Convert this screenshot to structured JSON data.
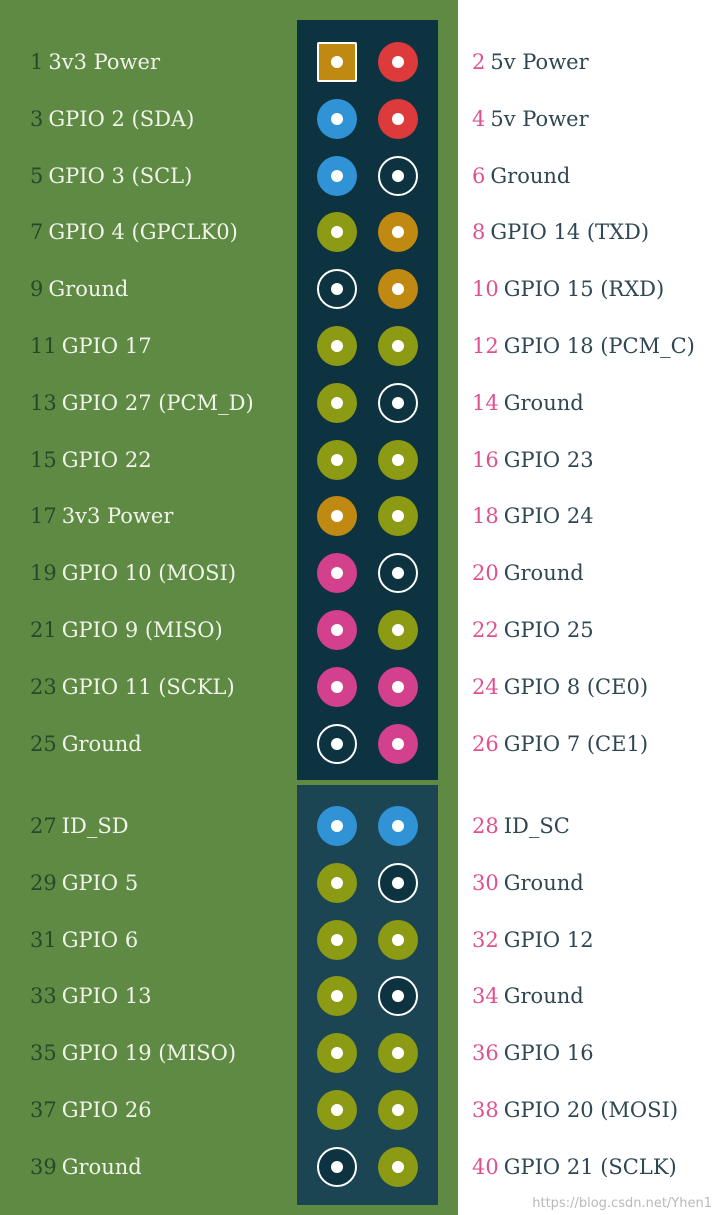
{
  "colors": {
    "power_3v3": "#c08a12",
    "power_5v": "#dd3b3b",
    "i2c": "#2f93d6",
    "ground": "#0d3341",
    "gpio": "#8c9a14",
    "uart": "#c08a12",
    "spi": "#d3408c",
    "eeprom": "#2f93d6"
  },
  "pins": [
    {
      "num": "1",
      "name": "3v3 Power",
      "type": "power_3v3",
      "shape": "square"
    },
    {
      "num": "2",
      "name": "5v Power",
      "type": "power_5v"
    },
    {
      "num": "3",
      "name": "GPIO 2 (SDA)",
      "type": "i2c"
    },
    {
      "num": "4",
      "name": "5v Power",
      "type": "power_5v"
    },
    {
      "num": "5",
      "name": "GPIO 3 (SCL)",
      "type": "i2c"
    },
    {
      "num": "6",
      "name": "Ground",
      "type": "ground"
    },
    {
      "num": "7",
      "name": "GPIO 4 (GPCLK0)",
      "type": "gpio"
    },
    {
      "num": "8",
      "name": "GPIO 14 (TXD)",
      "type": "uart"
    },
    {
      "num": "9",
      "name": "Ground",
      "type": "ground"
    },
    {
      "num": "10",
      "name": "GPIO 15 (RXD)",
      "type": "uart"
    },
    {
      "num": "11",
      "name": "GPIO 17",
      "type": "gpio"
    },
    {
      "num": "12",
      "name": "GPIO 18 (PCM_C)",
      "type": "gpio"
    },
    {
      "num": "13",
      "name": "GPIO 27 (PCM_D)",
      "type": "gpio"
    },
    {
      "num": "14",
      "name": "Ground",
      "type": "ground"
    },
    {
      "num": "15",
      "name": "GPIO 22",
      "type": "gpio"
    },
    {
      "num": "16",
      "name": "GPIO 23",
      "type": "gpio"
    },
    {
      "num": "17",
      "name": "3v3 Power",
      "type": "power_3v3"
    },
    {
      "num": "18",
      "name": "GPIO 24",
      "type": "gpio"
    },
    {
      "num": "19",
      "name": "GPIO 10 (MOSI)",
      "type": "spi"
    },
    {
      "num": "20",
      "name": "Ground",
      "type": "ground"
    },
    {
      "num": "21",
      "name": "GPIO 9 (MISO)",
      "type": "spi"
    },
    {
      "num": "22",
      "name": "GPIO 25",
      "type": "gpio"
    },
    {
      "num": "23",
      "name": "GPIO 11 (SCKL)",
      "type": "spi"
    },
    {
      "num": "24",
      "name": "GPIO 8 (CE0)",
      "type": "spi"
    },
    {
      "num": "25",
      "name": "Ground",
      "type": "ground"
    },
    {
      "num": "26",
      "name": "GPIO 7 (CE1)",
      "type": "spi"
    },
    {
      "num": "27",
      "name": "ID_SD",
      "type": "eeprom"
    },
    {
      "num": "28",
      "name": "ID_SC",
      "type": "eeprom"
    },
    {
      "num": "29",
      "name": "GPIO 5",
      "type": "gpio"
    },
    {
      "num": "30",
      "name": "Ground",
      "type": "ground"
    },
    {
      "num": "31",
      "name": "GPIO 6",
      "type": "gpio"
    },
    {
      "num": "32",
      "name": "GPIO 12",
      "type": "gpio"
    },
    {
      "num": "33",
      "name": "GPIO 13",
      "type": "gpio"
    },
    {
      "num": "34",
      "name": "Ground",
      "type": "ground"
    },
    {
      "num": "35",
      "name": "GPIO 19 (MISO)",
      "type": "gpio"
    },
    {
      "num": "36",
      "name": "GPIO 16",
      "type": "gpio"
    },
    {
      "num": "37",
      "name": "GPIO 26",
      "type": "gpio"
    },
    {
      "num": "38",
      "name": "GPIO 20 (MOSI)",
      "type": "gpio"
    },
    {
      "num": "39",
      "name": "Ground",
      "type": "ground"
    },
    {
      "num": "40",
      "name": "GPIO 21 (SCLK)",
      "type": "gpio"
    }
  ],
  "watermark": "https://blog.csdn.net/Yhen1"
}
